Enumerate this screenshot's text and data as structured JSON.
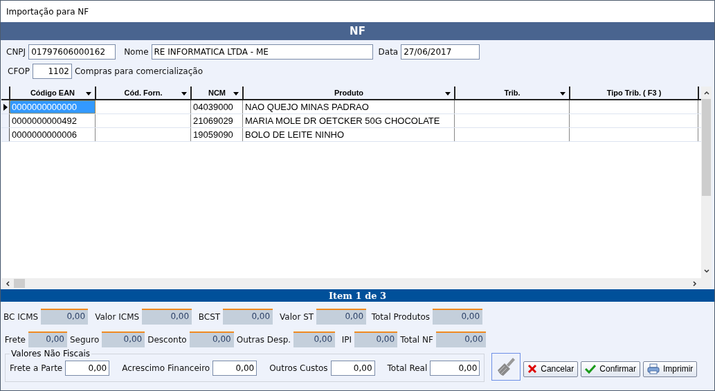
{
  "window": {
    "title": "Importação para NF"
  },
  "header": {
    "title": "NF"
  },
  "form": {
    "cnpj": {
      "label": "CNPJ",
      "value": "01797606000162"
    },
    "nome": {
      "label": "Nome",
      "value": "RE INFORMATICA LTDA - ME"
    },
    "data": {
      "label": "Data",
      "value": "27/06/2017"
    },
    "cfop": {
      "label": "CFOP",
      "value": "1102",
      "description": "Compras para comercialização"
    }
  },
  "table": {
    "columns": [
      {
        "label": "Código EAN",
        "dropdown": true
      },
      {
        "label": "Cód. Forn.",
        "dropdown": true
      },
      {
        "label": "NCM",
        "dropdown": true
      },
      {
        "label": "Produto",
        "dropdown": true
      },
      {
        "label": "Trib.",
        "dropdown": true
      },
      {
        "label": "Tipo Trib. ( F3 )",
        "dropdown": false
      }
    ],
    "rows": [
      {
        "selected": true,
        "cells": [
          "0000000000000",
          "",
          "04039000",
          "NAO QUEJO MINAS PADRAO",
          "",
          ""
        ]
      },
      {
        "selected": false,
        "cells": [
          "0000000000492",
          "",
          "21069029",
          "MARIA MOLE DR OETCKER 50G CHOCOLATE",
          "",
          ""
        ]
      },
      {
        "selected": false,
        "cells": [
          "0000000000006",
          "",
          "19059090",
          "BOLO DE LEITE NINHO",
          "",
          ""
        ]
      }
    ]
  },
  "item_bar": {
    "title": "Item 1 de 3"
  },
  "totals": [
    [
      {
        "label": "BC ICMS",
        "value": "0,00"
      },
      {
        "label": "Valor ICMS",
        "value": "0,00"
      },
      {
        "label": "BCST",
        "value": "0,00"
      },
      {
        "label": "Valor ST",
        "value": "0,00"
      },
      {
        "label": "Total Produtos",
        "value": "0,00"
      }
    ],
    [
      {
        "label": "Frete",
        "value": "0,00"
      },
      {
        "label": "Seguro",
        "value": "0,00"
      },
      {
        "label": "Desconto",
        "value": "0,00"
      },
      {
        "label": "Outras Desp.",
        "value": "0,00"
      },
      {
        "label": "IPI",
        "value": "0,00"
      },
      {
        "label": "Total NF",
        "value": "0,00"
      }
    ]
  ],
  "non_fiscal": {
    "legend": "Valores Não Fiscais",
    "fields": [
      {
        "label": "Frete a Parte",
        "value": "0,00"
      },
      {
        "label": "Acrescimo Financeiro",
        "value": "0,00"
      },
      {
        "label": "Outros Custos",
        "value": "0,00"
      },
      {
        "label": "Total Real",
        "value": "0,00"
      }
    ]
  },
  "buttons": [
    {
      "kind": "clean"
    },
    {
      "kind": "cancel",
      "label": "Cancelar"
    },
    {
      "kind": "confirm",
      "label": "Confirmar"
    },
    {
      "kind": "print",
      "label": "Imprimir"
    }
  ]
}
